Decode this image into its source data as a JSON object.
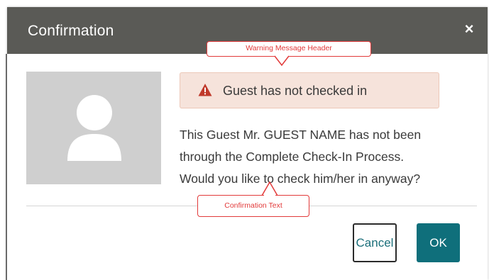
{
  "dialog": {
    "title": "Confirmation",
    "close_glyph": "×",
    "close_icon": "close-icon",
    "avatar_icon": "user-avatar-icon"
  },
  "warning": {
    "icon": "warning-triangle-icon",
    "icon_color": "#c0392b",
    "text": "Guest has not checked in"
  },
  "message": {
    "line1": "This Guest Mr. GUEST NAME has not been",
    "line2": "through the Complete Check-In Process.",
    "line3": "Would you like to check him/her in anyway?"
  },
  "buttons": {
    "cancel_label": "Cancel",
    "ok_label": "OK"
  },
  "annotations": {
    "header_callout": "Warning Message Header",
    "text_callout": "Confirmation Text",
    "color": "#e23a3a"
  },
  "colors": {
    "header_bg": "#5a5a56",
    "primary": "#0f6f7b",
    "warning_bg": "#f6e3db"
  }
}
